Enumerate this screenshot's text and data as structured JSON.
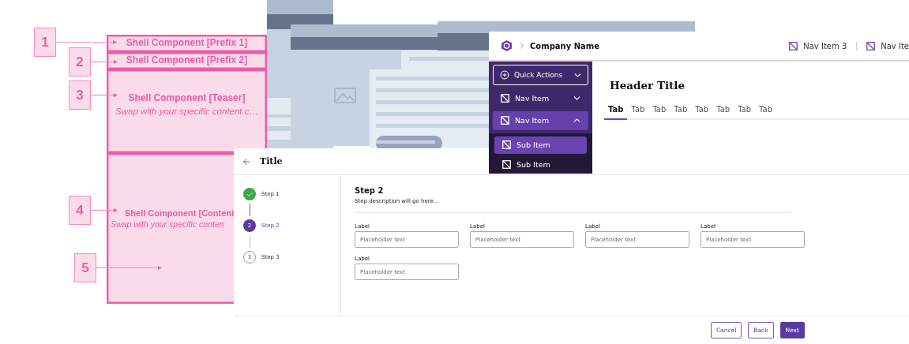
{
  "shell_diagram": {
    "callouts": [
      "1",
      "2",
      "3",
      "4",
      "5"
    ],
    "sections": [
      {
        "kind": "prefix",
        "title": "Shell Component [Prefix 1]"
      },
      {
        "kind": "prefix",
        "title": "Shell Component [Prefix 2]"
      },
      {
        "kind": "teaser",
        "title": "Shell Component [Teaser]",
        "subtitle": "Swap with your specific content c…"
      },
      {
        "kind": "content",
        "title": "Shell Component [Content",
        "subtitle": "Swap with your specific conten"
      }
    ]
  },
  "app_preview": {
    "company_name": "Company Name",
    "top_nav": [
      "Nav Item 3",
      "Nav Ite"
    ],
    "quick_actions": "Quick Actions",
    "sidebar": [
      {
        "label": "Nav Item",
        "expanded": false,
        "selected": false
      },
      {
        "label": "Nav Item",
        "expanded": true,
        "selected": true,
        "children": [
          {
            "label": "Sub Item",
            "selected": true
          },
          {
            "label": "Sub Item",
            "selected": false
          }
        ]
      }
    ],
    "header_title": "Header Title",
    "tabs": [
      {
        "label": "Tab",
        "selected": true
      },
      {
        "label": "Tab",
        "selected": false
      },
      {
        "label": "Tab",
        "selected": false
      },
      {
        "label": "Tab",
        "selected": false
      },
      {
        "label": "Tab",
        "selected": false
      },
      {
        "label": "Tab",
        "selected": false
      },
      {
        "label": "Tab",
        "selected": false
      },
      {
        "label": "Tab",
        "selected": false
      }
    ]
  },
  "wizard": {
    "title": "Title",
    "steps": [
      {
        "label": "Step 1",
        "completed": true,
        "selected": false
      },
      {
        "label": "Step 2",
        "number": "2",
        "completed": false,
        "selected": true
      },
      {
        "label": "Step 3",
        "number": "3",
        "completed": false,
        "selected": false
      }
    ],
    "step_heading": "Step 2",
    "step_description": "Step description will go here...",
    "fields": [
      {
        "label": "Label",
        "placeholder": "Placeholder text"
      },
      {
        "label": "Label",
        "placeholder": "Placeholder text"
      },
      {
        "label": "Label",
        "placeholder": "Placeholder text"
      },
      {
        "label": "Label",
        "placeholder": "Placeholder text"
      },
      {
        "label": "Label",
        "placeholder": "Placeholder text"
      }
    ],
    "buttons": [
      {
        "label": "Cancel",
        "kind": "secondary"
      },
      {
        "label": "Back",
        "kind": "secondary"
      },
      {
        "label": "Next",
        "kind": "primary"
      }
    ]
  }
}
